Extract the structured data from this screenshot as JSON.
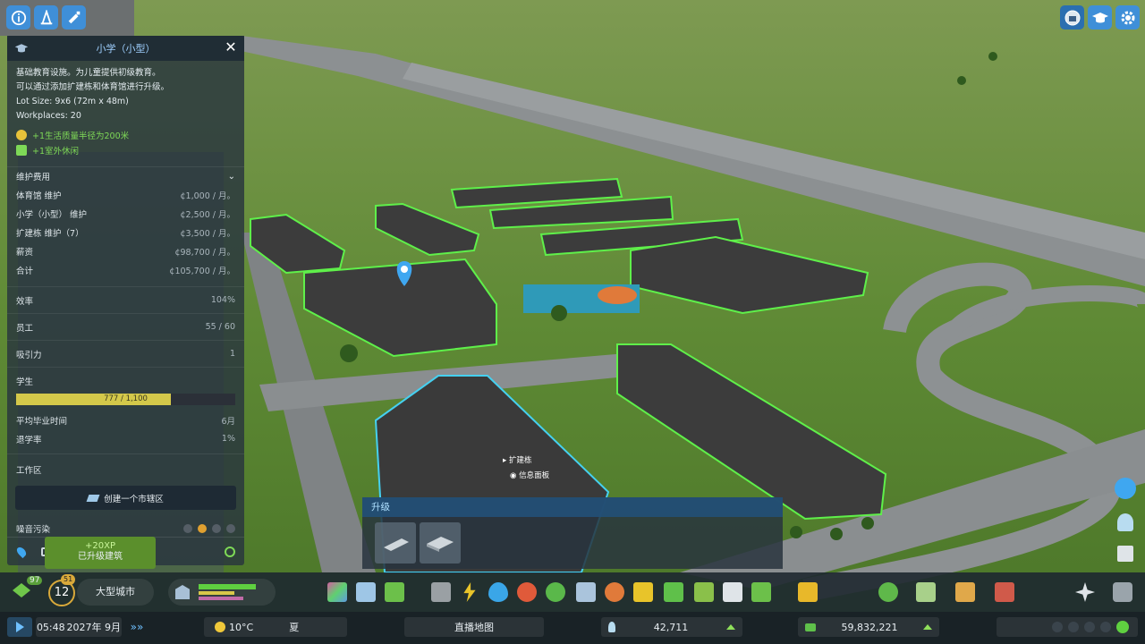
{
  "colors": {
    "accent": "#3f8fd8",
    "outline": "#5ff04a",
    "bar_fill": "#d4c84a",
    "xp_bg": "#5b8f2c"
  },
  "top_left": {
    "icons": [
      "info-icon",
      "traffic-cone-icon",
      "bulldoze-icon"
    ]
  },
  "top_right": {
    "icons": [
      "city-emblem-icon",
      "graduation-cap-icon",
      "settings-gear-icon"
    ]
  },
  "panel": {
    "title": "小学（小型）",
    "description": [
      "基础教育设施。为儿童提供初级教育。",
      "可以通过添加扩建栋和体育馆进行升级。",
      "Lot Size: 9x6 (72m x 48m)",
      "Workplaces: 20"
    ],
    "perks": [
      "+1生活质量半径为200米",
      "+1室外休闲"
    ],
    "upkeep_header": "维护费用",
    "upkeep": [
      {
        "label": "体育馆 维护",
        "value": "¢1,000 / 月。"
      },
      {
        "label": "小学（小型） 维护",
        "value": "¢2,500 / 月。"
      },
      {
        "label": "扩建栋 维护（7）",
        "value": "¢3,500 / 月。"
      },
      {
        "label": "薪资",
        "value": "¢98,700 / 月。"
      },
      {
        "label": "合计",
        "value": "¢105,700 / 月。"
      }
    ],
    "stats": [
      {
        "label": "效率",
        "value": "104%"
      },
      {
        "label": "员工",
        "value": "55 / 60"
      },
      {
        "label": "吸引力",
        "value": "1"
      }
    ],
    "students_label": "学生",
    "students_text": "777 / 1,100",
    "students_fraction": 0.706,
    "stats2": [
      {
        "label": "平均毕业时间",
        "value": "6月"
      },
      {
        "label": "退学率",
        "value": "1%"
      }
    ],
    "district_label": "工作区",
    "create_district": "创建一个市辖区",
    "noise_label": "噪音污染"
  },
  "xp": {
    "amount": "+20XP",
    "text": "已升级建筑"
  },
  "upgrade": {
    "title": "升级",
    "items": [
      "extension-wing-icon",
      "gymnasium-icon"
    ]
  },
  "context": {
    "items": [
      "扩建栋",
      "信息面板"
    ]
  },
  "bottom": {
    "level_badge": "97",
    "milestone": "12",
    "milestone_sup": "51",
    "city_tier": "大型城市",
    "time": "05:48",
    "date": "2027年 9月",
    "temperature": "10°C",
    "season": "夏",
    "map_label": "直播地图",
    "population": "42,711",
    "money": "59,832,221"
  }
}
